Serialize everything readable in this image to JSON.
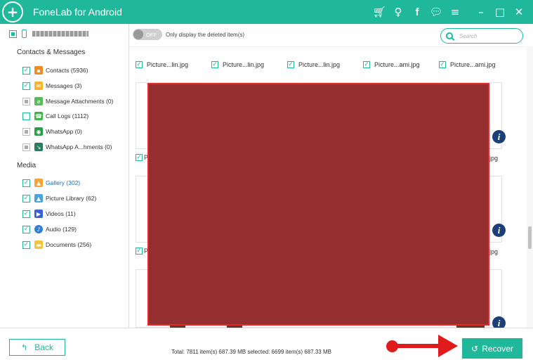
{
  "app": {
    "title": "FoneLab for Android"
  },
  "titlebar_icons": [
    "cart-icon",
    "key-icon",
    "facebook-icon",
    "chat-icon",
    "menu-icon",
    "minimize-icon",
    "maximize-icon",
    "close-icon"
  ],
  "colors": {
    "accent": "#1fb89a",
    "redaction": "#952f2f",
    "annotation_red": "#e01b1b",
    "info_icon": "#1b3f77",
    "active_link": "#1a6fc9"
  },
  "sidebar": {
    "sections": [
      {
        "title": "Contacts & Messages",
        "items": [
          {
            "label": "Contacts (5936)",
            "state": "checked",
            "icon": "contacts-icon",
            "color": "#f08a24"
          },
          {
            "label": "Messages (3)",
            "state": "checked",
            "icon": "messages-icon",
            "color": "#f5b52e"
          },
          {
            "label": "Message Attachments (0)",
            "state": "partial",
            "icon": "attachment-icon",
            "color": "#5cb85c"
          },
          {
            "label": "Call Logs (1112)",
            "state": "unchecked",
            "icon": "call-logs-icon",
            "color": "#3cb54a"
          },
          {
            "label": "WhatsApp (0)",
            "state": "partial",
            "icon": "whatsapp-icon",
            "color": "#2a9d4c"
          },
          {
            "label": "WhatsApp A...hments (0)",
            "state": "partial",
            "icon": "whatsapp-attachments-icon",
            "color": "#2a7d5c"
          }
        ]
      },
      {
        "title": "Media",
        "items": [
          {
            "label": "Gallery (302)",
            "state": "checked",
            "icon": "gallery-icon",
            "color": "#f2a33a",
            "active": true
          },
          {
            "label": "Picture Library (62)",
            "state": "checked",
            "icon": "picture-library-icon",
            "color": "#4aa3df"
          },
          {
            "label": "Videos (11)",
            "state": "checked",
            "icon": "videos-icon",
            "color": "#3b5fd9"
          },
          {
            "label": "Audio (129)",
            "state": "checked",
            "icon": "audio-icon",
            "color": "#2f7fd6"
          },
          {
            "label": "Documents (256)",
            "state": "checked",
            "icon": "documents-icon",
            "color": "#f5c542"
          }
        ]
      }
    ]
  },
  "toolbar": {
    "toggle_state": "OFF",
    "toggle_label": "Only display the deleted item(s)",
    "search_placeholder": "Search"
  },
  "grid": {
    "row1_labels": [
      "Picture...lin.jpg",
      "Picture...lin.jpg",
      "Picture...lin.jpg",
      "Picture...ami.jpg",
      "Picture...ami.jpg"
    ],
    "row2_visible": {
      "left": "P",
      "right": "jpg"
    },
    "row3_visible": {
      "left": "P",
      "right": "jpg"
    }
  },
  "footer": {
    "back_label": "Back",
    "summary": "Total: 7811 item(s) 687.39 MB   selected: 6699 item(s) 687.33 MB",
    "recover_label": "Recover"
  }
}
